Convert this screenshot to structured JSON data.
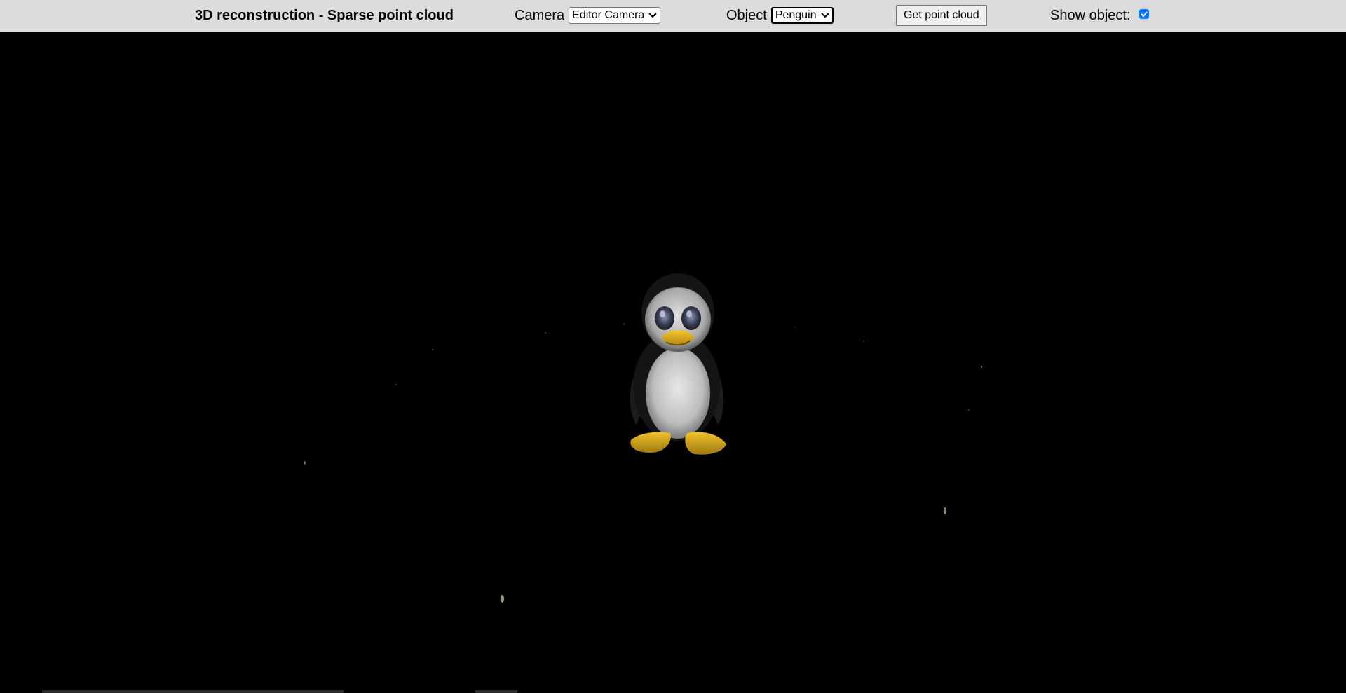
{
  "toolbar": {
    "title": "3D reconstruction - Sparse point cloud",
    "camera_label": "Camera",
    "camera_selected": "Editor Camera",
    "object_label": "Object",
    "object_selected": "Penguin",
    "get_point_cloud_label": "Get point cloud",
    "show_object_label": "Show object:",
    "show_object_checked": true
  },
  "icons": {
    "dropdown": "chevron-down-icon",
    "checkbox": "checkmark-icon"
  },
  "scene": {
    "object": "penguin",
    "background_color": "#000000"
  },
  "colors": {
    "toolbar_bg": "#dcdcdc",
    "checkbox_accent": "#0075ff",
    "penguin_feet": "#e0b020"
  }
}
